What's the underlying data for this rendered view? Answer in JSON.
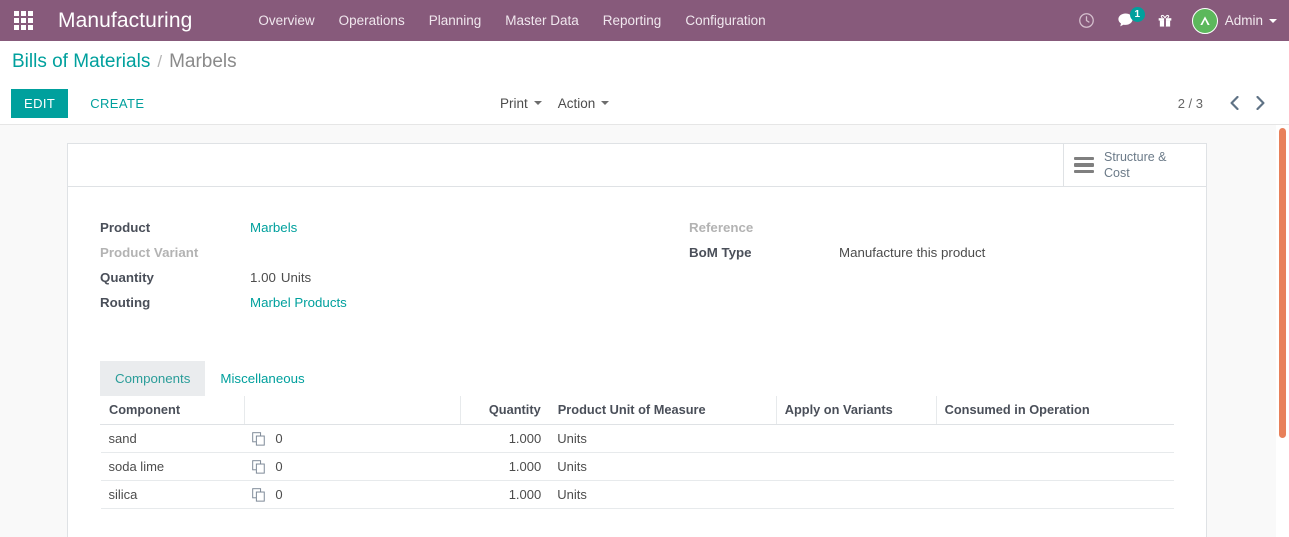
{
  "navbar": {
    "apps_icon": "apps-grid-icon",
    "brand": "Manufacturing",
    "menu_items": [
      {
        "label": "Overview"
      },
      {
        "label": "Operations"
      },
      {
        "label": "Planning"
      },
      {
        "label": "Master Data"
      },
      {
        "label": "Reporting"
      },
      {
        "label": "Configuration"
      }
    ],
    "systray": {
      "activity_icon": "clock-icon",
      "messaging_icon": "chat-bubble-icon",
      "messaging_badge": "1",
      "gift_icon": "gift-icon",
      "user_name": "Admin",
      "avatar_icon": "user-avatar-icon"
    },
    "background_color": "#875A7B"
  },
  "breadcrumb": {
    "root": "Bills of Materials",
    "separator": "/",
    "current": "Marbels"
  },
  "control_panel": {
    "edit_label": "EDIT",
    "create_label": "CREATE",
    "print_label": "Print",
    "action_label": "Action",
    "pager_value": "2 / 3",
    "prev_icon": "chevron-left-icon",
    "next_icon": "chevron-right-icon",
    "accent_color": "#00A09D"
  },
  "sheet": {
    "stat_button": {
      "icon": "list-lines-icon",
      "label_line1": "Structure &",
      "label_line2": "Cost"
    },
    "fields_left": [
      {
        "label": "Product",
        "value": "Marbels",
        "type": "link"
      },
      {
        "label": "Product Variant",
        "value": "",
        "type": "empty"
      },
      {
        "label": "Quantity",
        "value": "1.00",
        "unit": "Units",
        "type": "number"
      },
      {
        "label": "Routing",
        "value": "Marbel Products",
        "type": "link"
      }
    ],
    "fields_right": [
      {
        "label": "Reference",
        "value": "",
        "type": "empty"
      },
      {
        "label": "BoM Type",
        "value": "Manufacture this product",
        "type": "text"
      }
    ],
    "tabs": [
      {
        "label": "Components",
        "active": true
      },
      {
        "label": "Miscellaneous",
        "active": false
      }
    ],
    "table": {
      "headers": [
        "Component",
        "",
        "Quantity",
        "Product Unit of Measure",
        "Apply on Variants",
        "Consumed in Operation"
      ],
      "rows": [
        {
          "component": "sand",
          "variant_icon": "copy-documents-icon",
          "variant_count": "0",
          "quantity": "1.000",
          "uom": "Units",
          "apply_on_variants": "",
          "consumed_in_operation": ""
        },
        {
          "component": "soda lime",
          "variant_icon": "copy-documents-icon",
          "variant_count": "0",
          "quantity": "1.000",
          "uom": "Units",
          "apply_on_variants": "",
          "consumed_in_operation": ""
        },
        {
          "component": "silica",
          "variant_icon": "copy-documents-icon",
          "variant_count": "0",
          "quantity": "1.000",
          "uom": "Units",
          "apply_on_variants": "",
          "consumed_in_operation": ""
        }
      ]
    }
  },
  "scrollbar": {
    "color": "#E8805A"
  }
}
